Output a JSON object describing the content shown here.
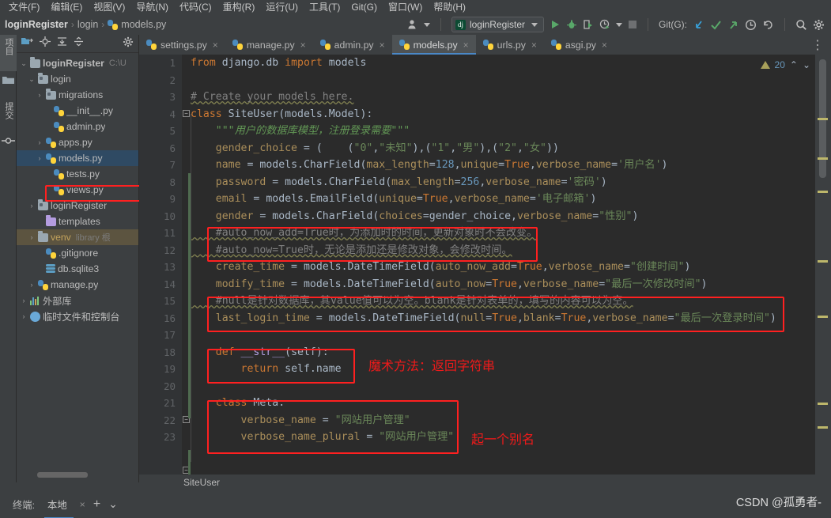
{
  "menubar": {
    "items": [
      {
        "label": "文件(F)"
      },
      {
        "label": "编辑(E)"
      },
      {
        "label": "视图(V)"
      },
      {
        "label": "导航(N)"
      },
      {
        "label": "代码(C)"
      },
      {
        "label": "重构(R)"
      },
      {
        "label": "运行(U)"
      },
      {
        "label": "工具(T)"
      },
      {
        "label": "Git(G)"
      },
      {
        "label": "窗口(W)"
      },
      {
        "label": "帮助(H)"
      }
    ]
  },
  "navbar": {
    "breadcrumbs": [
      {
        "label": "loginRegister",
        "bold": true
      },
      {
        "label": "login",
        "bold": false
      },
      {
        "label": "models.py",
        "bold": false,
        "icon": "python-file-icon"
      }
    ],
    "separator": "›",
    "run_config": "loginRegister",
    "run_config_badge": "dj",
    "git_label": "Git(G):",
    "icons": [
      "user-icon",
      "run-icon",
      "debug-icon",
      "run-coverage-icon",
      "profile-icon",
      "stop-icon",
      "git-update-icon",
      "git-commit-icon",
      "git-push-icon",
      "git-history-icon",
      "git-revert-icon",
      "search-everywhere-icon",
      "settings-icon"
    ]
  },
  "left_strip": {
    "tabs": [
      {
        "label": "项目",
        "selected": true,
        "name": "tool-window-project"
      },
      {
        "label": "提交",
        "selected": false,
        "name": "tool-window-commit"
      }
    ],
    "icons": [
      "folder-icon",
      "structure-icon"
    ]
  },
  "project_panel": {
    "toolbar_icons": [
      "select-opened-file-icon",
      "locate-icon",
      "expand-all-icon",
      "collapse-all-icon",
      "settings-icon"
    ],
    "tree": [
      {
        "indent": 0,
        "arrow": "v",
        "icon": "folder-icon",
        "label": "loginRegister",
        "suffix": "C:\\U",
        "selected": false,
        "bold": true
      },
      {
        "indent": 1,
        "arrow": "v",
        "icon": "module-folder-icon",
        "label": "login",
        "suffix": "",
        "selected": false
      },
      {
        "indent": 2,
        "arrow": ">",
        "icon": "module-folder-icon",
        "label": "migrations",
        "suffix": "",
        "selected": false
      },
      {
        "indent": 3,
        "arrow": "",
        "icon": "python-file-icon",
        "label": "__init__.py",
        "suffix": "",
        "selected": false
      },
      {
        "indent": 3,
        "arrow": "",
        "icon": "python-file-icon",
        "label": "admin.py",
        "suffix": "",
        "selected": false
      },
      {
        "indent": 2,
        "arrow": ">",
        "icon": "python-file-icon",
        "label": "apps.py",
        "suffix": "",
        "selected": false
      },
      {
        "indent": 2,
        "arrow": ">",
        "icon": "python-file-icon",
        "label": "models.py",
        "suffix": "",
        "selected": true,
        "highlight_box": true
      },
      {
        "indent": 3,
        "arrow": "",
        "icon": "python-file-icon",
        "label": "tests.py",
        "suffix": "",
        "selected": false
      },
      {
        "indent": 3,
        "arrow": "",
        "icon": "python-file-icon",
        "label": "views.py",
        "suffix": "",
        "selected": false
      },
      {
        "indent": 1,
        "arrow": ">",
        "icon": "module-folder-icon",
        "label": "loginRegister",
        "suffix": "",
        "selected": false
      },
      {
        "indent": 2,
        "arrow": "",
        "icon": "templates-folder-icon",
        "label": "templates",
        "suffix": "",
        "selected": false
      },
      {
        "indent": 1,
        "arrow": ">",
        "icon": "folder-icon",
        "label": "venv",
        "suffix": "library 根",
        "selected": false,
        "venv": true
      },
      {
        "indent": 2,
        "arrow": "",
        "icon": "gitignore-file-icon",
        "label": ".gitignore",
        "suffix": "",
        "selected": false
      },
      {
        "indent": 2,
        "arrow": "",
        "icon": "database-file-icon",
        "label": "db.sqlite3",
        "suffix": "",
        "selected": false
      },
      {
        "indent": 1,
        "arrow": ">",
        "icon": "python-file-icon",
        "label": "manage.py",
        "suffix": "",
        "selected": false
      },
      {
        "indent": 0,
        "arrow": ">",
        "icon": "external-libraries-icon",
        "label": "外部库",
        "suffix": "",
        "selected": false
      },
      {
        "indent": 0,
        "arrow": ">",
        "icon": "scratches-icon",
        "label": "临时文件和控制台",
        "suffix": "",
        "selected": false
      }
    ]
  },
  "editor_tabs": {
    "tabs": [
      {
        "label": "settings.py",
        "active": false
      },
      {
        "label": "manage.py",
        "active": false
      },
      {
        "label": "admin.py",
        "active": false
      },
      {
        "label": "models.py",
        "active": true
      },
      {
        "label": "urls.py",
        "active": false
      },
      {
        "label": "asgi.py",
        "active": false
      }
    ],
    "close_glyph": "×",
    "more_glyph": "⋮"
  },
  "inspection": {
    "warning_count": "20",
    "up_glyph": "⌃",
    "down_glyph": "⌄"
  },
  "editor": {
    "line_numbers": [
      "1",
      "2",
      "3",
      "4",
      "5",
      "6",
      "7",
      "8",
      "9",
      "10",
      "11",
      "12",
      "13",
      "14",
      "15",
      "16",
      "17",
      "18",
      "19",
      "20",
      "21",
      "22",
      "23"
    ],
    "code_lines": [
      "from django.db import models",
      "",
      "# Create your models here.",
      "class SiteUser(models.Model):",
      "    \"\"\"用户的数据库模型，注册登录需要\"\"\"",
      "    gender_choice = (    (\"0\",\"未知\"),(\"1\",\"男\"),(\"2\",\"女\"))",
      "    name = models.CharField(max_length=128,unique=True,verbose_name='用户名')",
      "    password = models.CharField(max_length=256,verbose_name='密码')",
      "    email = models.EmailField(unique=True,verbose_name='电子邮箱')",
      "    gender = models.CharField(choices=gender_choice,verbose_name=\"性别\")",
      "    #auto_now_add=True时，为添加时的时间，更新对象时不会改变。",
      "    #auto_now=True时，无论是添加还是修改对象，会修改时间。",
      "    create_time = models.DateTimeField(auto_now_add=True,verbose_name=\"创建时间\")",
      "    modify_time = models.DateTimeField(auto_now=True,verbose_name=\"最后一次修改时间\")",
      "    #null是针对数据库，其value值可以为空。blank是针对表单的，填写的内容可以为空。",
      "    last_login_time = models.DateTimeField(null=True,blank=True,verbose_name=\"最后一次登录时间\")",
      "",
      "    def __str__(self):",
      "        return self.name",
      "",
      "    class Meta:",
      "        verbose_name = \"网站用户管理\"",
      "        verbose_name_plural = \"网站用户管理\""
    ],
    "annotations": [
      {
        "text": "魔术方法：返回字符串",
        "name": "annotation-magic-method"
      },
      {
        "text": "起一个别名",
        "name": "annotation-alias"
      }
    ],
    "breadcrumb": "SiteUser"
  },
  "bottom": {
    "terminal_label": "终端:",
    "local_tab": "本地",
    "close_glyph": "×",
    "add_glyph": "+",
    "dropdown_glyph": "⌄"
  },
  "watermark": "CSDN @孤勇者-",
  "colors": {
    "accent": "#4a88c7",
    "annotation_red": "#ff2020",
    "selection_blue": "#2f4a63",
    "editor_bg": "#2b2b2b",
    "panel_bg": "#3c3f41"
  }
}
